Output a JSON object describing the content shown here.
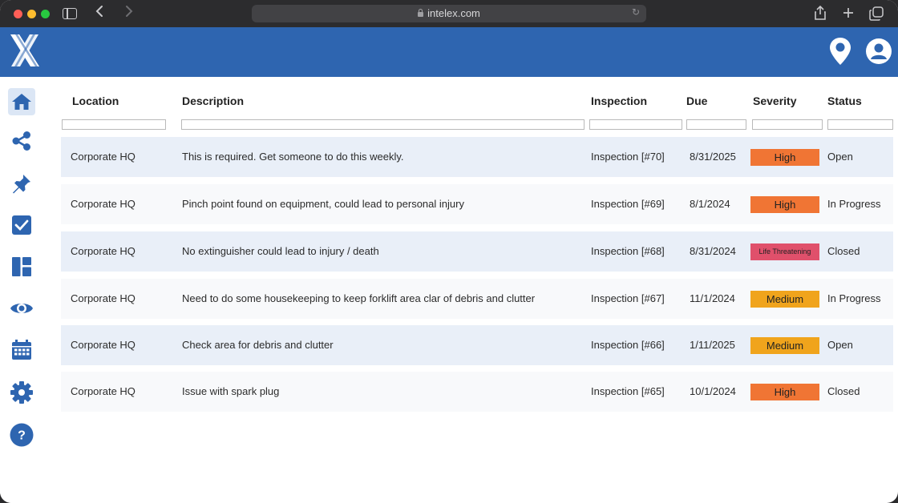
{
  "browser": {
    "url": "intelex.com"
  },
  "colors": {
    "header": "#2e65b0",
    "row_alt": "#e9eff8",
    "high": "#f07534",
    "medium": "#f0a41c",
    "life_threatening": "#e0506b"
  },
  "header": {
    "icons": [
      "location-pin-icon",
      "user-account-icon"
    ]
  },
  "nav": {
    "items": [
      {
        "icon": "home-icon",
        "active": true
      },
      {
        "icon": "share-icon"
      },
      {
        "icon": "pin-icon"
      },
      {
        "icon": "checkbox-icon"
      },
      {
        "icon": "dashboard-icon"
      },
      {
        "icon": "eye-icon"
      },
      {
        "icon": "calendar-icon"
      },
      {
        "icon": "settings-icon"
      },
      {
        "icon": "help-icon"
      }
    ],
    "help_label": "?"
  },
  "table": {
    "columns": [
      "Location",
      "Description",
      "Inspection",
      "Due",
      "Severity",
      "Status"
    ],
    "rows": [
      {
        "location": "Corporate HQ",
        "description": "This is required. Get someone to do this weekly.",
        "inspection": "Inspection [#70]",
        "due": "8/31/2025",
        "severity": "High",
        "status": "Open"
      },
      {
        "location": "Corporate HQ",
        "description": "Pinch point found on equipment, could lead to personal injury",
        "inspection": "Inspection [#69]",
        "due": "8/1/2024",
        "severity": "High",
        "status": "In Progress"
      },
      {
        "location": "Corporate HQ",
        "description": "No extinguisher could lead to injury / death",
        "inspection": "Inspection [#68]",
        "due": "8/31/2024",
        "severity": "Life Threatening",
        "status": "Closed"
      },
      {
        "location": "Corporate HQ",
        "description": "Need to do some housekeeping to keep forklift area clar of debris and clutter",
        "inspection": "Inspection [#67]",
        "due": "11/1/2024",
        "severity": "Medium",
        "status": "In Progress"
      },
      {
        "location": "Corporate HQ",
        "description": "Check area for debris and clutter",
        "inspection": "Inspection [#66]",
        "due": "1/11/2025",
        "severity": "Medium",
        "status": "Open"
      },
      {
        "location": "Corporate HQ",
        "description": "Issue with spark plug",
        "inspection": "Inspection [#65]",
        "due": "10/1/2024",
        "severity": "High",
        "status": "Closed"
      }
    ]
  }
}
